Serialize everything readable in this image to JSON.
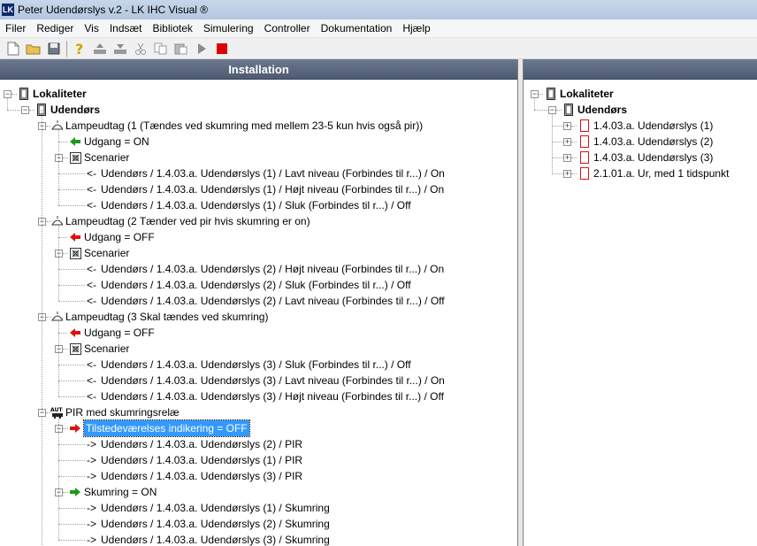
{
  "window": {
    "title": "Peter Udendørslys v.2 - LK IHC Visual ®",
    "app_icon_text": "LK"
  },
  "menu": [
    "Filer",
    "Rediger",
    "Vis",
    "Indsæt",
    "Bibliotek",
    "Simulering",
    "Controller",
    "Dokumentation",
    "Hjælp"
  ],
  "left_panel": {
    "header": "Installation",
    "root": "Lokaliteter",
    "location": "Udendørs",
    "nodes": [
      {
        "kind": "lamp",
        "label": "Lampeudtag (1 (Tændes ved skumring med mellem 23-5 kun hvis også pir))"
      },
      {
        "kind": "out_on",
        "label": "Udgang = ON"
      },
      {
        "kind": "scen",
        "label": "Scenarier"
      },
      {
        "kind": "link",
        "arrow": "<-",
        "label": "Udendørs / 1.4.03.a. Udendørslys (1) / Lavt niveau (Forbindes til r...) / On"
      },
      {
        "kind": "link",
        "arrow": "<-",
        "label": "Udendørs / 1.4.03.a. Udendørslys (1) / Højt niveau (Forbindes til r...) / On"
      },
      {
        "kind": "link",
        "arrow": "<-",
        "label": "Udendørs / 1.4.03.a. Udendørslys (1) / Sluk (Forbindes til r...) / Off"
      },
      {
        "kind": "lamp",
        "label": "Lampeudtag (2 Tænder ved pir hvis skumring er on)"
      },
      {
        "kind": "out_off",
        "label": "Udgang = OFF"
      },
      {
        "kind": "scen",
        "label": "Scenarier"
      },
      {
        "kind": "link",
        "arrow": "<-",
        "label": "Udendørs / 1.4.03.a. Udendørslys (2) / Højt niveau (Forbindes til r...) / On"
      },
      {
        "kind": "link",
        "arrow": "<-",
        "label": "Udendørs / 1.4.03.a. Udendørslys (2) / Sluk (Forbindes til r...) / Off"
      },
      {
        "kind": "link",
        "arrow": "<-",
        "label": "Udendørs / 1.4.03.a. Udendørslys (2) / Lavt niveau (Forbindes til r...) / Off"
      },
      {
        "kind": "lamp",
        "label": "Lampeudtag (3 Skal tændes ved skumring)"
      },
      {
        "kind": "out_off",
        "label": "Udgang = OFF"
      },
      {
        "kind": "scen",
        "label": "Scenarier"
      },
      {
        "kind": "link",
        "arrow": "<-",
        "label": "Udendørs / 1.4.03.a. Udendørslys (3) / Sluk (Forbindes til r...) / Off"
      },
      {
        "kind": "link",
        "arrow": "<-",
        "label": "Udendørs / 1.4.03.a. Udendørslys (3) / Lavt niveau (Forbindes til r...) / On"
      },
      {
        "kind": "link",
        "arrow": "<-",
        "label": "Udendørs / 1.4.03.a. Udendørslys (3) / Højt niveau (Forbindes til r...) / Off"
      },
      {
        "kind": "pir",
        "label": "PIR med skumringsrelæ",
        "icon_text": "AUTO"
      },
      {
        "kind": "in_sel",
        "label": "Tilstedeværelses indikering = OFF"
      },
      {
        "kind": "link2",
        "arrow": "->",
        "label": "Udendørs / 1.4.03.a. Udendørslys (2) / PIR"
      },
      {
        "kind": "link2",
        "arrow": "->",
        "label": "Udendørs / 1.4.03.a. Udendørslys (1) / PIR"
      },
      {
        "kind": "link2",
        "arrow": "->",
        "label": "Udendørs / 1.4.03.a. Udendørslys (3) / PIR"
      },
      {
        "kind": "in_on",
        "label": "Skumring = ON"
      },
      {
        "kind": "link2",
        "arrow": "->",
        "label": "Udendørs / 1.4.03.a. Udendørslys (1) / Skumring"
      },
      {
        "kind": "link2",
        "arrow": "->",
        "label": "Udendørs / 1.4.03.a. Udendørslys (2) / Skumring"
      },
      {
        "kind": "link2",
        "arrow": "->",
        "label": "Udendørs / 1.4.03.a. Udendørslys (3) / Skumring"
      }
    ]
  },
  "right_panel": {
    "root": "Lokaliteter",
    "location": "Udendørs",
    "items": [
      "1.4.03.a. Udendørslys (1)",
      "1.4.03.a. Udendørslys (2)",
      "1.4.03.a. Udendørslys (3)",
      "2.1.01.a. Ur, med 1 tidspunkt"
    ]
  },
  "colors": {
    "on_arrow": "#1a9a1a",
    "off_arrow": "#e01010",
    "selection": "#3399ff",
    "header": "#56637a",
    "stop": "#e00000"
  }
}
